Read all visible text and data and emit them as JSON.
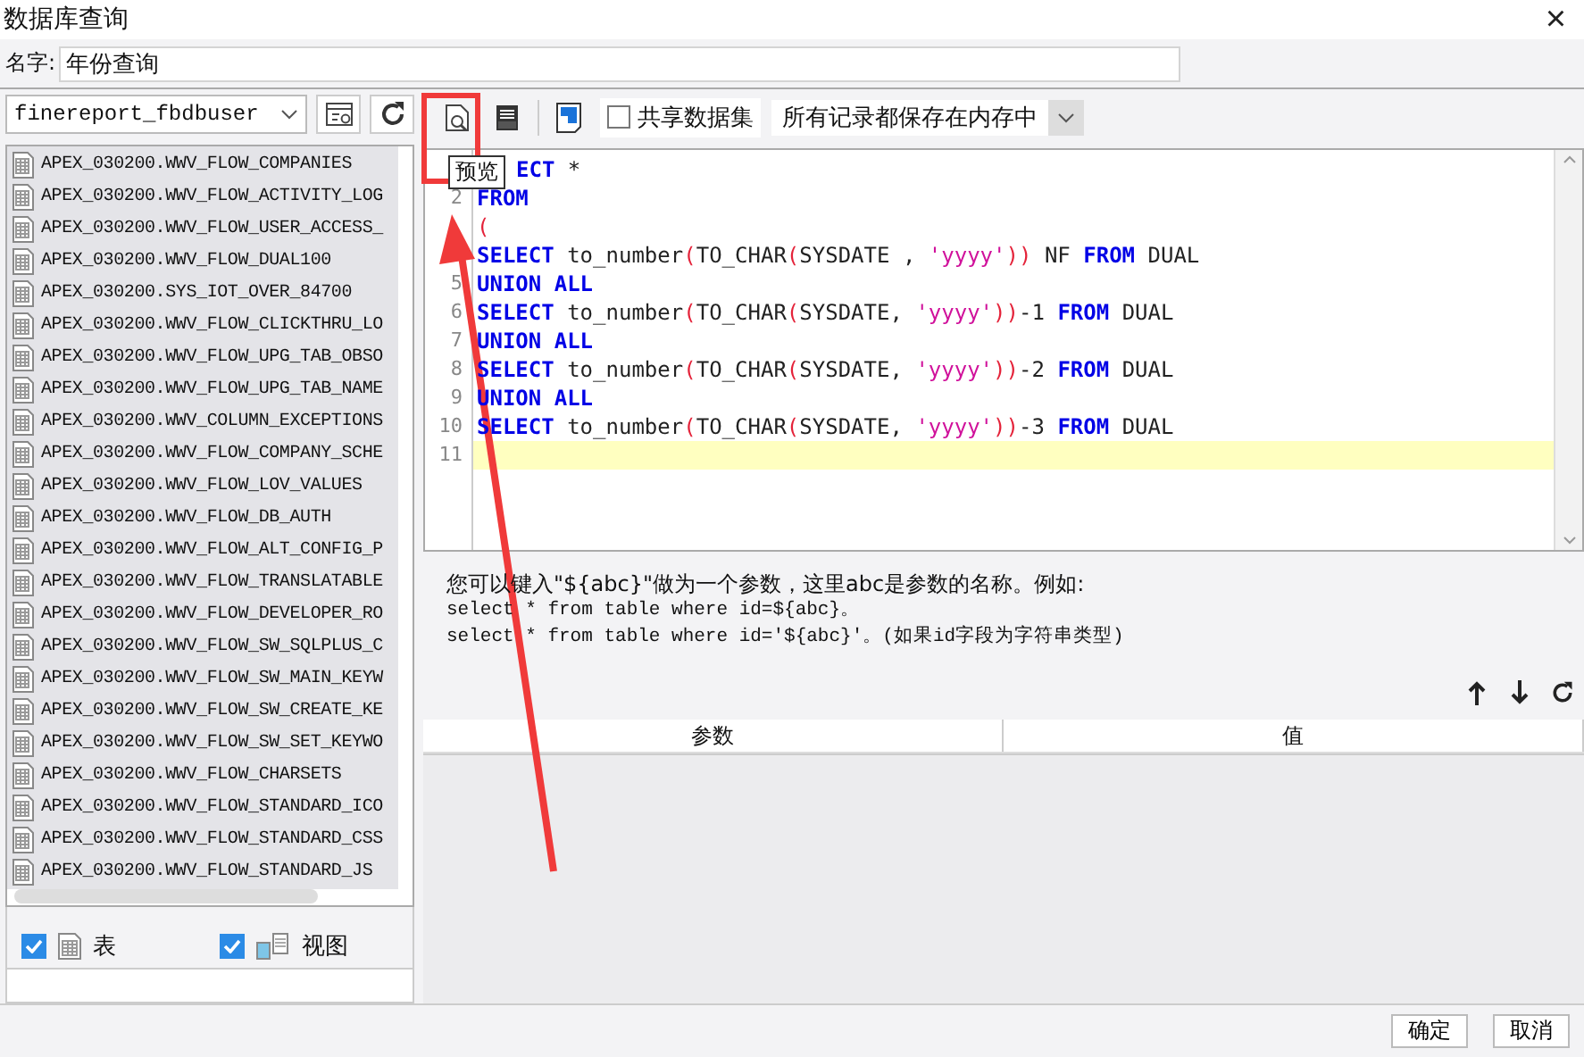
{
  "window": {
    "title": "数据库查询",
    "close": "×"
  },
  "name_field": {
    "label": "名字:",
    "value": "年份查询"
  },
  "connection": {
    "value": "finereport_fbdbuser"
  },
  "tables": [
    {
      "name": "APEX_030200.WWV_FLOW_COMPANIES"
    },
    {
      "name": "APEX_030200.WWV_FLOW_ACTIVITY_LOG"
    },
    {
      "name": "APEX_030200.WWV_FLOW_USER_ACCESS_"
    },
    {
      "name": "APEX_030200.WWV_FLOW_DUAL100"
    },
    {
      "name": "APEX_030200.SYS_IOT_OVER_84700"
    },
    {
      "name": "APEX_030200.WWV_FLOW_CLICKTHRU_LO"
    },
    {
      "name": "APEX_030200.WWV_FLOW_UPG_TAB_OBSO"
    },
    {
      "name": "APEX_030200.WWV_FLOW_UPG_TAB_NAME"
    },
    {
      "name": "APEX_030200.WWV_COLUMN_EXCEPTIONS"
    },
    {
      "name": "APEX_030200.WWV_FLOW_COMPANY_SCHE"
    },
    {
      "name": "APEX_030200.WWV_FLOW_LOV_VALUES"
    },
    {
      "name": "APEX_030200.WWV_FLOW_DB_AUTH"
    },
    {
      "name": "APEX_030200.WWV_FLOW_ALT_CONFIG_P"
    },
    {
      "name": "APEX_030200.WWV_FLOW_TRANSLATABLE"
    },
    {
      "name": "APEX_030200.WWV_FLOW_DEVELOPER_RO"
    },
    {
      "name": "APEX_030200.WWV_FLOW_SW_SQLPLUS_C"
    },
    {
      "name": "APEX_030200.WWV_FLOW_SW_MAIN_KEYW"
    },
    {
      "name": "APEX_030200.WWV_FLOW_SW_CREATE_KE"
    },
    {
      "name": "APEX_030200.WWV_FLOW_SW_SET_KEYWO"
    },
    {
      "name": "APEX_030200.WWV_FLOW_CHARSETS"
    },
    {
      "name": "APEX_030200.WWV_FLOW_STANDARD_ICO"
    },
    {
      "name": "APEX_030200.WWV_FLOW_STANDARD_CSS"
    },
    {
      "name": "APEX_030200.WWV_FLOW_STANDARD_JS"
    }
  ],
  "filters": [
    {
      "kind": "table",
      "label": "表",
      "checked": true
    },
    {
      "kind": "view",
      "label": "视图",
      "checked": true
    }
  ],
  "toolbar": {
    "share_label": "共享数据集",
    "share_checked": false,
    "storage": "所有记录都保存在内存中",
    "tooltip": "预览"
  },
  "code_lines": [
    {
      "tokens": [
        {
          "kind": "keyword",
          "text": "ECT"
        },
        {
          "kind": "plain",
          "text": " *"
        }
      ]
    },
    {
      "number": "2",
      "tokens": [
        {
          "kind": "keyword",
          "text": "FROM"
        }
      ]
    },
    {
      "tokens": [
        {
          "kind": "paren",
          "text": "("
        }
      ]
    },
    {
      "tokens": [
        {
          "kind": "keyword",
          "text": "SELECT"
        },
        {
          "kind": "plain",
          "text": " to_number"
        },
        {
          "kind": "paren",
          "text": "("
        },
        {
          "kind": "plain",
          "text": "TO_CHAR"
        },
        {
          "kind": "paren",
          "text": "("
        },
        {
          "kind": "plain",
          "text": "SYSDATE , "
        },
        {
          "kind": "string",
          "text": "'yyyy'"
        },
        {
          "kind": "paren",
          "text": "))"
        },
        {
          "kind": "plain",
          "text": " NF "
        },
        {
          "kind": "keyword",
          "text": "FROM"
        },
        {
          "kind": "plain",
          "text": " DUAL"
        }
      ]
    },
    {
      "number": "5",
      "tokens": [
        {
          "kind": "keyword",
          "text": "UNION ALL"
        }
      ]
    },
    {
      "number": "6",
      "tokens": [
        {
          "kind": "keyword",
          "text": "SELECT"
        },
        {
          "kind": "plain",
          "text": " to_number"
        },
        {
          "kind": "paren",
          "text": "("
        },
        {
          "kind": "plain",
          "text": "TO_CHAR"
        },
        {
          "kind": "paren",
          "text": "("
        },
        {
          "kind": "plain",
          "text": "SYSDATE, "
        },
        {
          "kind": "string",
          "text": "'yyyy'"
        },
        {
          "kind": "paren",
          "text": "))"
        },
        {
          "kind": "plain",
          "text": "-1 "
        },
        {
          "kind": "keyword",
          "text": "FROM"
        },
        {
          "kind": "plain",
          "text": " DUAL"
        }
      ]
    },
    {
      "number": "7",
      "tokens": [
        {
          "kind": "keyword",
          "text": "UNION ALL"
        }
      ]
    },
    {
      "number": "8",
      "tokens": [
        {
          "kind": "keyword",
          "text": "SELECT"
        },
        {
          "kind": "plain",
          "text": " to_number"
        },
        {
          "kind": "paren",
          "text": "("
        },
        {
          "kind": "plain",
          "text": "TO_CHAR"
        },
        {
          "kind": "paren",
          "text": "("
        },
        {
          "kind": "plain",
          "text": "SYSDATE, "
        },
        {
          "kind": "string",
          "text": "'yyyy'"
        },
        {
          "kind": "paren",
          "text": "))"
        },
        {
          "kind": "plain",
          "text": "-2 "
        },
        {
          "kind": "keyword",
          "text": "FROM"
        },
        {
          "kind": "plain",
          "text": " DUAL"
        }
      ]
    },
    {
      "number": "9",
      "tokens": [
        {
          "kind": "keyword",
          "text": "UNION ALL"
        }
      ]
    },
    {
      "number": "10",
      "tokens": [
        {
          "kind": "keyword",
          "text": "SELECT"
        },
        {
          "kind": "plain",
          "text": " to_number"
        },
        {
          "kind": "paren",
          "text": "("
        },
        {
          "kind": "plain",
          "text": "TO_CHAR"
        },
        {
          "kind": "paren",
          "text": "("
        },
        {
          "kind": "plain",
          "text": "SYSDATE, "
        },
        {
          "kind": "string",
          "text": "'yyyy'"
        },
        {
          "kind": "paren",
          "text": "))"
        },
        {
          "kind": "plain",
          "text": "-3 "
        },
        {
          "kind": "keyword",
          "text": "FROM"
        },
        {
          "kind": "plain",
          "text": " DUAL"
        }
      ]
    },
    {
      "number": "11",
      "current": true
    }
  ],
  "help_lines": [
    {
      "kind": "text",
      "text": "您可以键入\"${abc}\"做为一个参数，这里abc是参数的名称。例如:"
    },
    {
      "kind": "code",
      "text": "select * from table where id=${abc}。"
    },
    {
      "kind": "code",
      "text": "select * from table where id='${abc}'。(如果id字段为字符串类型)"
    }
  ],
  "param_table": {
    "columns": [
      "参数",
      "值"
    ]
  },
  "buttons": [
    "确定",
    "取消"
  ]
}
